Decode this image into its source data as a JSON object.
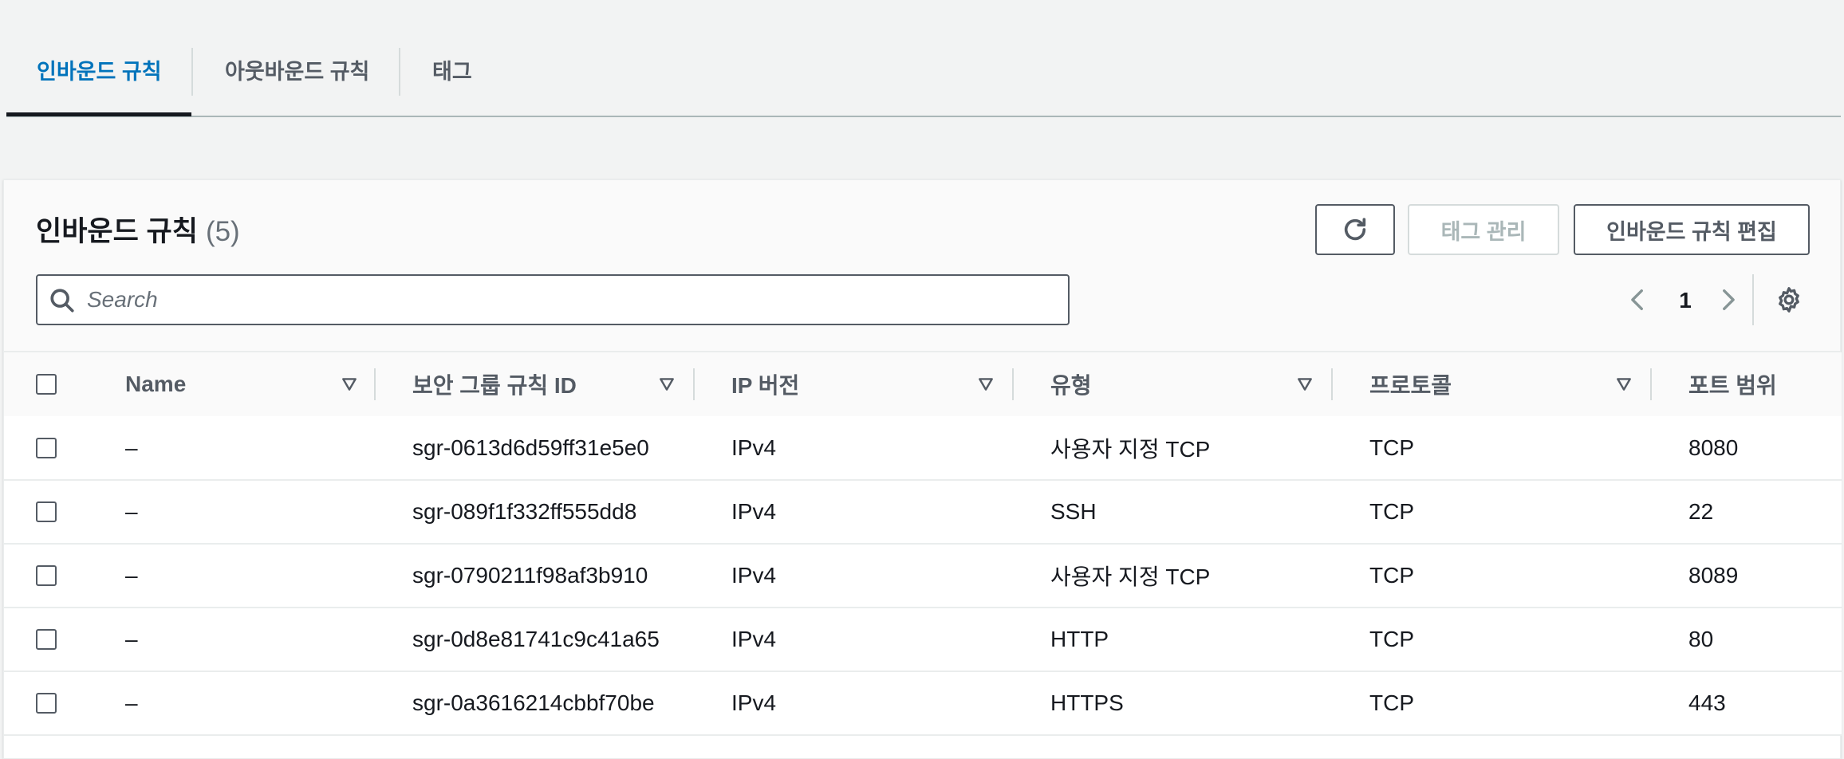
{
  "tabs": [
    {
      "label": "인바운드 규칙",
      "active": true
    },
    {
      "label": "아웃바운드 규칙",
      "active": false
    },
    {
      "label": "태그",
      "active": false
    }
  ],
  "panel": {
    "title": "인바운드 규칙",
    "count": "(5)",
    "buttons": {
      "refresh_icon": "refresh-icon",
      "manage_tags": "태그 관리",
      "edit_inbound": "인바운드 규칙 편집"
    },
    "search": {
      "placeholder": "Search",
      "value": ""
    },
    "pagination": {
      "current_page": "1"
    }
  },
  "table": {
    "columns": [
      "Name",
      "보안 그룹 규칙 ID",
      "IP 버전",
      "유형",
      "프로토콜",
      "포트 범위"
    ],
    "rows": [
      {
        "name": "–",
        "rule_id": "sgr-0613d6d59ff31e5e0",
        "ip_version": "IPv4",
        "type": "사용자 지정 TCP",
        "protocol": "TCP",
        "port_range": "8080"
      },
      {
        "name": "–",
        "rule_id": "sgr-089f1f332ff555dd8",
        "ip_version": "IPv4",
        "type": "SSH",
        "protocol": "TCP",
        "port_range": "22"
      },
      {
        "name": "–",
        "rule_id": "sgr-0790211f98af3b910",
        "ip_version": "IPv4",
        "type": "사용자 지정 TCP",
        "protocol": "TCP",
        "port_range": "8089"
      },
      {
        "name": "–",
        "rule_id": "sgr-0d8e81741c9c41a65",
        "ip_version": "IPv4",
        "type": "HTTP",
        "protocol": "TCP",
        "port_range": "80"
      },
      {
        "name": "–",
        "rule_id": "sgr-0a3616214cbbf70be",
        "ip_version": "IPv4",
        "type": "HTTPS",
        "protocol": "TCP",
        "port_range": "443"
      }
    ]
  },
  "colors": {
    "accent": "#0073bb",
    "text": "#16191f",
    "muted": "#545b64",
    "disabled": "#aab7b8"
  }
}
